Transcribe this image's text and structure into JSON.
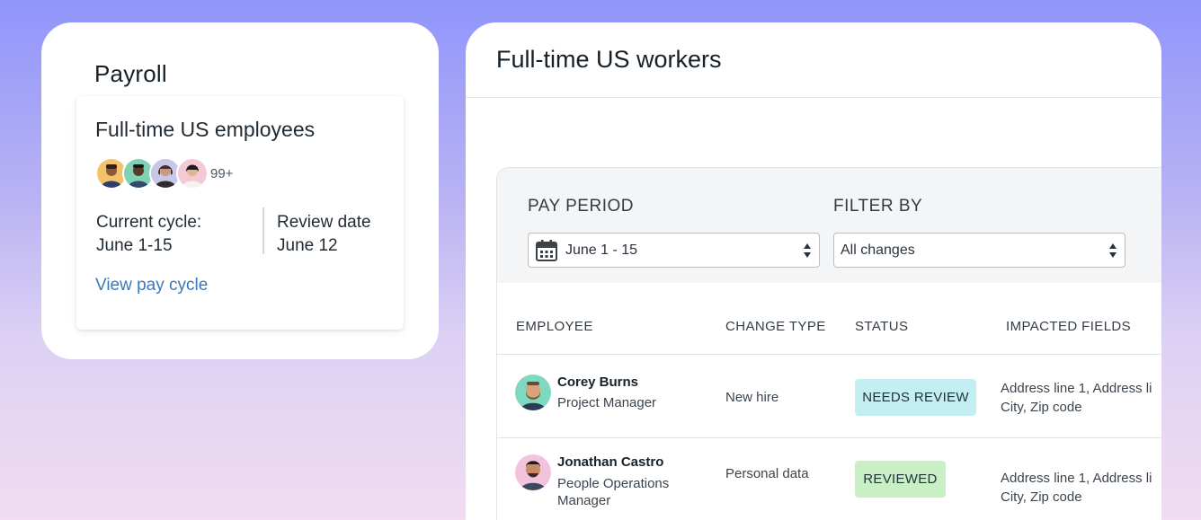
{
  "payroll": {
    "title": "Payroll",
    "card": {
      "title": "Full-time US employees",
      "avatars": [
        "employee-avatar-1",
        "employee-avatar-2",
        "employee-avatar-3",
        "employee-avatar-4"
      ],
      "more_count": "99+",
      "current_cycle_label": "Current cycle:",
      "current_cycle_value": "June 1-15",
      "review_date_label": "Review date",
      "review_date_value": "June 12",
      "link_label": "View pay cycle"
    }
  },
  "workers": {
    "title": "Full-time US workers",
    "pay_period": {
      "label": "PAY PERIOD",
      "value": "June 1 - 15",
      "icon": "calendar-icon"
    },
    "filter_by": {
      "label": "FILTER BY",
      "value": "All changes"
    },
    "columns": [
      "EMPLOYEE",
      "CHANGE TYPE",
      "STATUS",
      "IMPACTED FIELDS"
    ],
    "rows": [
      {
        "name": "Corey Burns",
        "role": "Project Manager",
        "change_type": "New hire",
        "status": "NEEDS REVIEW",
        "fields_line1": "Address line 1, Address li",
        "fields_line2": "City, Zip code"
      },
      {
        "name": "Jonathan Castro",
        "role": "People Operations Manager",
        "change_type": "Personal data",
        "status": "REVIEWED",
        "fields_line1": "Address line 1, Address li",
        "fields_line2": "City, Zip code"
      }
    ]
  },
  "colors": {
    "link": "#3b78b9",
    "needs_review_bg": "#c3eef2",
    "reviewed_bg": "#c9f0c4"
  }
}
